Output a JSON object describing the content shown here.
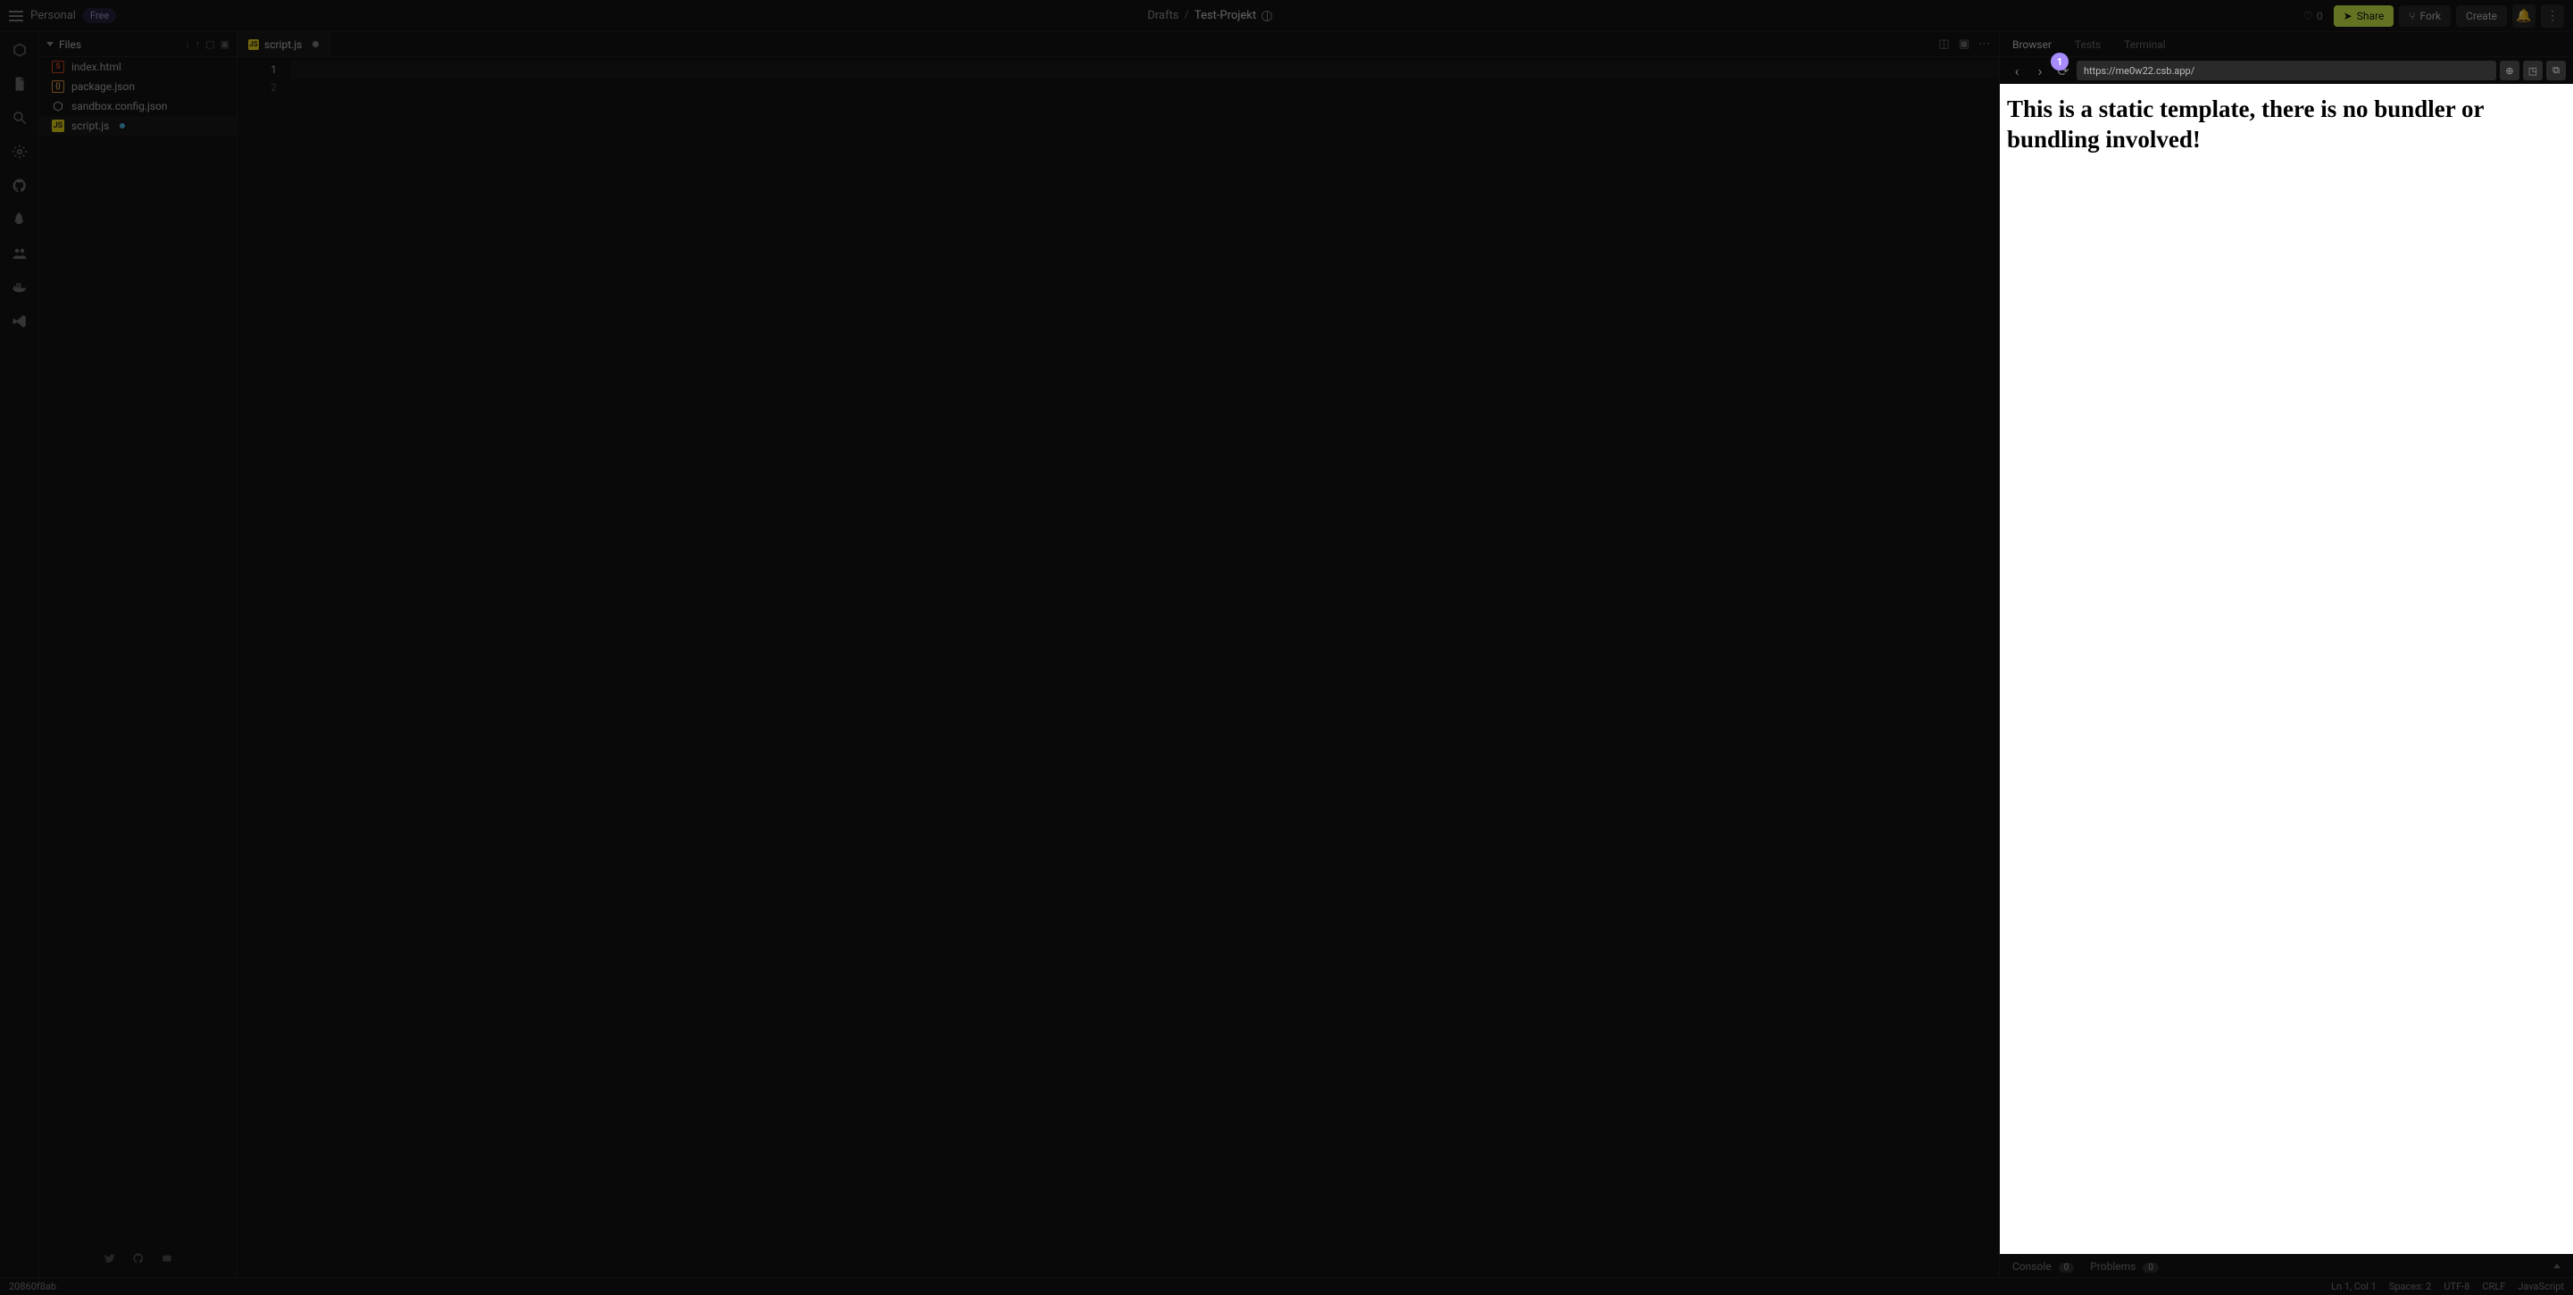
{
  "header": {
    "workspace": "Personal",
    "plan_badge": "Free",
    "breadcrumb": {
      "drafts": "Drafts",
      "sep": "/",
      "project": "Test-Projekt"
    },
    "likes": "0",
    "share": "Share",
    "fork": "Fork",
    "create": "Create"
  },
  "sidebar": {
    "title": "Files",
    "files": [
      {
        "name": "index.html",
        "icon": "html"
      },
      {
        "name": "package.json",
        "icon": "json"
      },
      {
        "name": "sandbox.config.json",
        "icon": "cfg"
      },
      {
        "name": "script.js",
        "icon": "js",
        "unsaved": true,
        "active": true
      }
    ]
  },
  "editor": {
    "tab": {
      "filename": "script.js",
      "icon_label": "JS"
    },
    "gutter": [
      "1",
      "2"
    ],
    "current_line": 1
  },
  "preview": {
    "tabs": {
      "browser": "Browser",
      "tests": "Tests",
      "terminal": "Terminal"
    },
    "tour_step": "1",
    "url": "https://me0w22.csb.app/",
    "frame_heading": "This is a static template, there is no bundler or bundling involved!",
    "footer": {
      "console": "Console",
      "console_count": "0",
      "problems": "Problems",
      "problems_count": "0"
    }
  },
  "status": {
    "sha": "20860f8ab",
    "ln_col": "Ln 1, Col 1",
    "spaces": "Spaces: 2",
    "encoding": "UTF-8",
    "eol": "CRLF",
    "lang": "JavaScript"
  },
  "icons": {
    "js_label": "JS",
    "html_label": "5",
    "json_label": "{}"
  }
}
